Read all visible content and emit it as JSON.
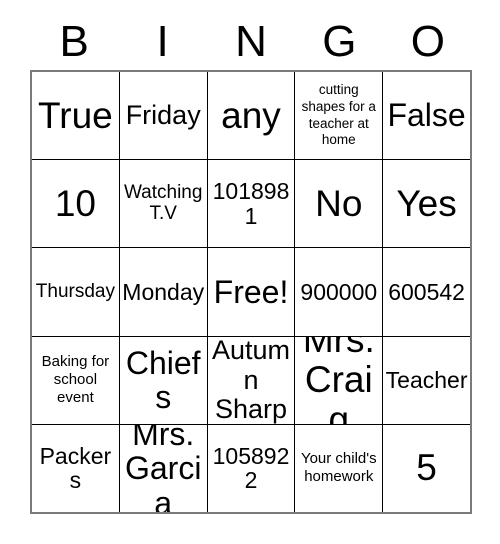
{
  "card": {
    "type": "bingo-card",
    "header_letters": [
      "B",
      "I",
      "N",
      "G",
      "O"
    ],
    "colors": {
      "background": "#ffffff",
      "text": "#000000",
      "grid_border": "#7a7a7a",
      "cell_border": "#000000"
    },
    "free_space": {
      "row": 3,
      "column": 3,
      "label": "Free!"
    },
    "rows": [
      {
        "cells": [
          {
            "text": "True"
          },
          {
            "text": "Friday"
          },
          {
            "text": "any"
          },
          {
            "text": "cutting shapes for a teacher at home"
          },
          {
            "text": "False"
          }
        ]
      },
      {
        "cells": [
          {
            "text": "10"
          },
          {
            "text": "Watching T.V"
          },
          {
            "text": "1018981"
          },
          {
            "text": "No"
          },
          {
            "text": "Yes"
          }
        ]
      },
      {
        "cells": [
          {
            "text": "Thursday"
          },
          {
            "text": "Monday"
          },
          {
            "text": "Free!"
          },
          {
            "text": "900000"
          },
          {
            "text": "600542"
          }
        ]
      },
      {
        "cells": [
          {
            "text": "Baking for school event"
          },
          {
            "text": "Chiefs"
          },
          {
            "text": "Autumn Sharp"
          },
          {
            "text": "Mrs. Craig"
          },
          {
            "text": "Teacher"
          }
        ]
      },
      {
        "cells": [
          {
            "text": "Packers"
          },
          {
            "text": "Mrs. Garcia"
          },
          {
            "text": "1058922"
          },
          {
            "text": "Your child's homework"
          },
          {
            "text": "5"
          }
        ]
      }
    ]
  }
}
